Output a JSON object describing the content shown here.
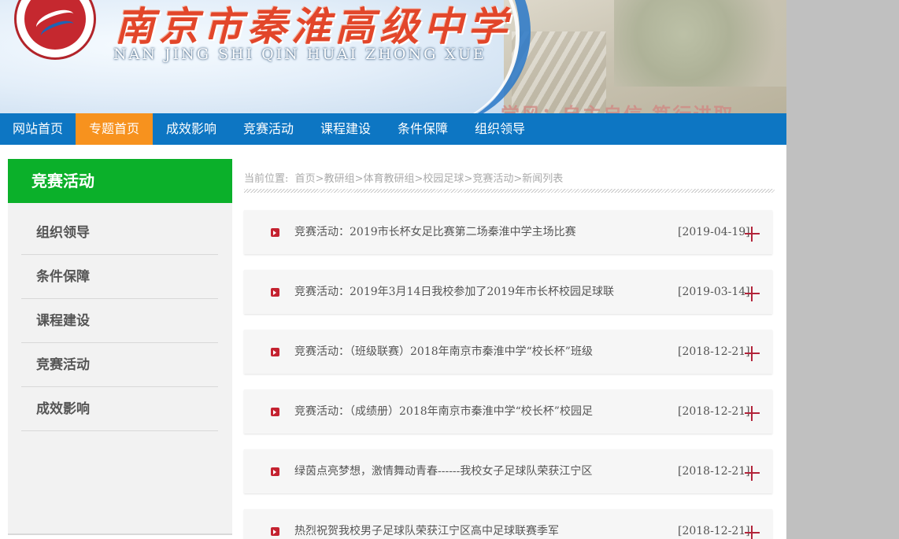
{
  "header": {
    "school_name": "南京市秦淮高级中学",
    "school_pinyin": "NAN JING SHI QIN HUAI  ZHONG XUE",
    "motto": "学风：自主自信 笃行进取"
  },
  "nav": {
    "items": [
      {
        "label": "网站首页",
        "active": false
      },
      {
        "label": "专题首页",
        "active": true
      },
      {
        "label": "成效影响",
        "active": false
      },
      {
        "label": "竞赛活动",
        "active": false
      },
      {
        "label": "课程建设",
        "active": false
      },
      {
        "label": "条件保障",
        "active": false
      },
      {
        "label": "组织领导",
        "active": false
      }
    ]
  },
  "sidebar": {
    "title": "竞赛活动",
    "items": [
      {
        "label": "组织领导"
      },
      {
        "label": "条件保障"
      },
      {
        "label": "课程建设"
      },
      {
        "label": "竞赛活动"
      },
      {
        "label": "成效影响"
      }
    ]
  },
  "breadcrumb": {
    "prefix": "当前位置:",
    "items": [
      "首页",
      "教研组",
      "体育教研组",
      "校园足球",
      "竞赛活动",
      "新闻列表"
    ],
    "separator": ">"
  },
  "news": [
    {
      "title": "竞赛活动：2019市长杯女足比赛第二场秦淮中学主场比赛",
      "date": "[2019-04-19]"
    },
    {
      "title": "竞赛活动：2019年3月14日我校参加了2019年市长杯校园足球联",
      "date": "[2019-03-14]"
    },
    {
      "title": "竞赛活动：（班级联赛）2018年南京市秦淮中学“校长杯”班级",
      "date": "[2018-12-21]"
    },
    {
      "title": "竞赛活动：（成绩册）2018年南京市秦淮中学“校长杯”校园足",
      "date": "[2018-12-21]"
    },
    {
      "title": "绿茵点亮梦想，激情舞动青春------我校女子足球队荣获江宁区",
      "date": "[2018-12-21]"
    },
    {
      "title": "热烈祝贺我校男子足球队荣获江宁区高中足球联赛季军",
      "date": "[2018-12-21]"
    }
  ],
  "colors": {
    "nav_bg": "#0d76c3",
    "nav_active": "#f7921e",
    "sidebar_title": "#0bb02a",
    "bullet": "#c42230"
  },
  "icons": [
    "school-logo",
    "bullet-arrow-icon",
    "plus-icon"
  ]
}
